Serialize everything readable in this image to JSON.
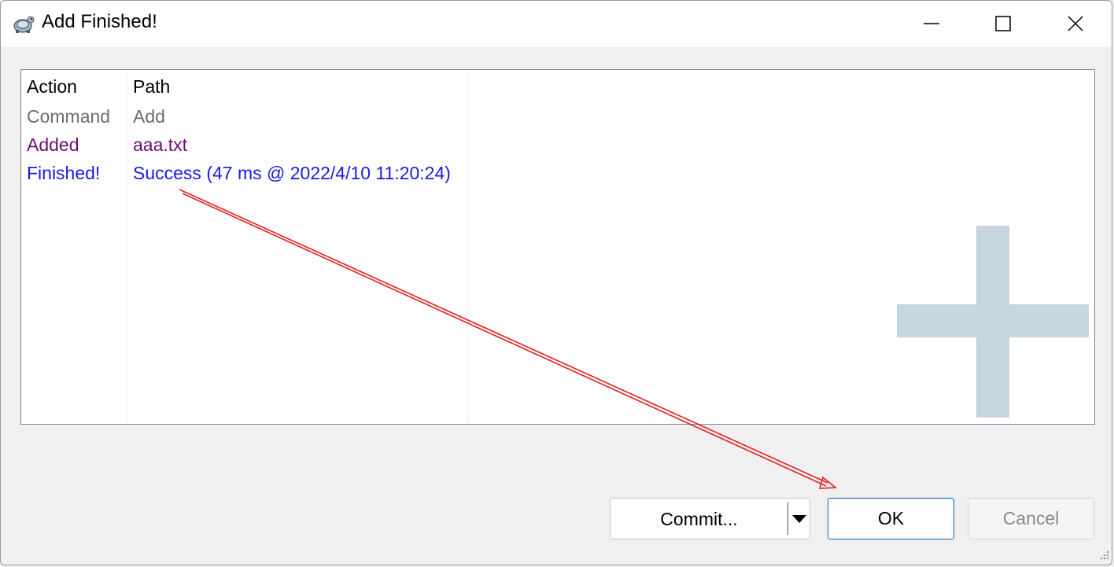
{
  "window": {
    "title": "Add Finished!"
  },
  "title_controls": {
    "minimize_icon": "minimize-icon",
    "maximize_icon": "maximize-icon",
    "close_icon": "close-icon"
  },
  "list": {
    "columns": [
      "Action",
      "Path"
    ],
    "rows": [
      {
        "action": "Command",
        "path": "Add",
        "color": "#6d6d6d"
      },
      {
        "action": "Added",
        "path": "aaa.txt",
        "color": "#6b0d74"
      },
      {
        "action": "Finished!",
        "path": "Success (47 ms @ 2022/4/10 11:20:24)",
        "color": "#1a1ae0"
      }
    ]
  },
  "buttons": {
    "commit": "Commit...",
    "ok": "OK",
    "cancel": "Cancel"
  },
  "colors": {
    "accent": "#0067c0",
    "annotation_arrow": "#e02020",
    "watermark": "#c5d6de"
  }
}
